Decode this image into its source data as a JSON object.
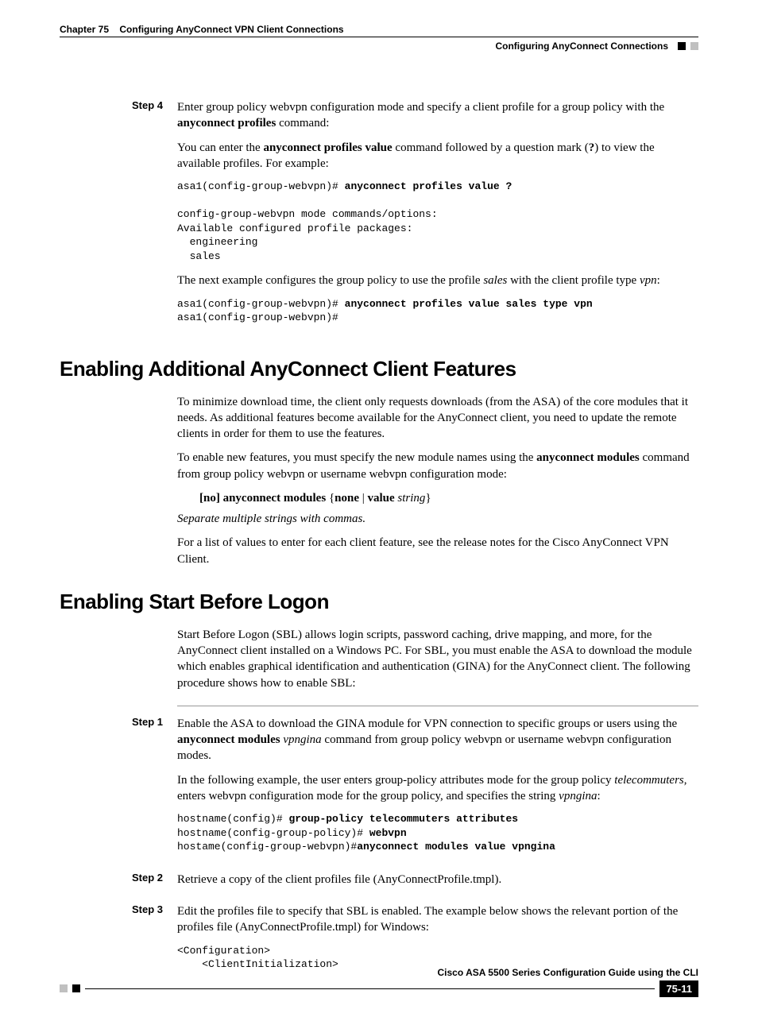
{
  "header": {
    "chapter": "Chapter 75",
    "chapter_title": "Configuring AnyConnect VPN Client Connections",
    "section": "Configuring AnyConnect Connections"
  },
  "step4": {
    "label": "Step 4",
    "p1a": "Enter group policy webvpn configuration mode and specify a client profile for a group policy with the ",
    "p1b": "anyconnect profiles",
    "p1c": " command:",
    "p2a": "You can enter the ",
    "p2b": "anyconnect profiles value",
    "p2c": " command followed by a question mark (",
    "p2d": "?",
    "p2e": ") to view the available profiles. For example:",
    "code1_prompt": "asa1(config-group-webvpn)# ",
    "code1_cmd": "anyconnect profiles value ?",
    "code1_rest": "config-group-webvpn mode commands/options:\nAvailable configured profile packages:\n  engineering\n  sales",
    "p3a": "The next example configures the group policy to use the profile ",
    "p3b": "sales",
    "p3c": " with the client profile type ",
    "p3d": "vpn",
    "p3e": ":",
    "code2_prompt1": "asa1(config-group-webvpn)# ",
    "code2_cmd": "anyconnect profiles value sales type vpn",
    "code2_prompt2": "asa1(config-group-webvpn)#"
  },
  "sec1": {
    "title": "Enabling Additional AnyConnect Client Features",
    "p1": "To minimize download time, the client only requests downloads (from the ASA) of the core modules that it needs. As additional features become available for the AnyConnect client, you need to update the remote clients in order for them to use the features.",
    "p2a": "To enable new features, you must specify the new module names using the ",
    "p2b": "anyconnect modules",
    "p2c": " command from group policy webvpn or username webvpn configuration mode:",
    "syntax_a": "[no]",
    "syntax_b": " anyconnect modules ",
    "syntax_c": "{",
    "syntax_d": "none",
    "syntax_e": " | ",
    "syntax_f": "value ",
    "syntax_g": "string",
    "syntax_h": "}",
    "p3": "Separate multiple strings with commas.",
    "p4": "For a list of values to enter for each client feature, see the release notes for the Cisco AnyConnect VPN Client."
  },
  "sec2": {
    "title": "Enabling Start Before Logon",
    "p1": "Start Before Logon (SBL) allows login scripts, password caching, drive mapping, and more, for the AnyConnect client installed on a Windows PC. For SBL, you must enable the ASA to download the module which enables graphical identification and authentication (GINA) for the AnyConnect client. The following procedure shows how to enable SBL:"
  },
  "sbl_step1": {
    "label": "Step 1",
    "p1a": "Enable the ASA to download the GINA module for VPN connection to specific groups or users using the ",
    "p1b": "anyconnect modules",
    "p1c": " ",
    "p1d": "vpngina",
    "p1e": " command from group policy webvpn or username webvpn configuration modes.",
    "p2a": "In the following example, the user enters group-policy attributes mode for the group policy ",
    "p2b": "telecommuters",
    "p2c": ", enters webvpn configuration mode for the group policy, and specifies the string ",
    "p2d": "vpngina",
    "p2e": ":",
    "code_l1a": "hostname(config)# ",
    "code_l1b": "group-policy telecommuters attributes",
    "code_l2a": "hostname(config-group-policy)# ",
    "code_l2b": "webvpn",
    "code_l3a": "hostame(config-group-webvpn)#",
    "code_l3b": "anyconnect modules value vpngina"
  },
  "sbl_step2": {
    "label": "Step 2",
    "p1": "Retrieve a copy of the client profiles file (AnyConnectProfile.tmpl)."
  },
  "sbl_step3": {
    "label": "Step 3",
    "p1": "Edit the profiles file to specify that SBL is enabled. The example below shows the relevant portion of the profiles file (AnyConnectProfile.tmpl) for Windows:",
    "code": "<Configuration>\n    <ClientInitialization>"
  },
  "footer": {
    "book": "Cisco ASA 5500 Series Configuration Guide using the CLI",
    "page": "75-11"
  }
}
